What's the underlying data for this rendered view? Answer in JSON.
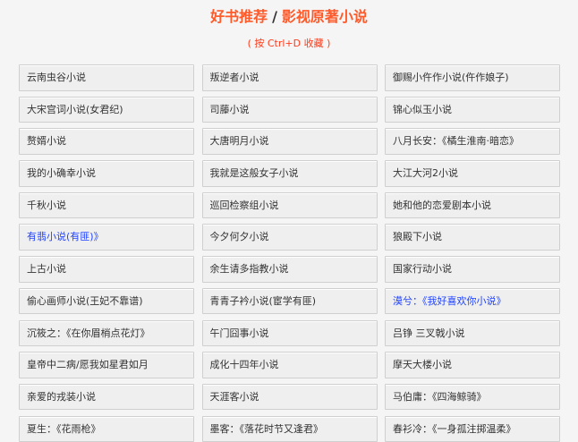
{
  "header": {
    "title_left": "好书推荐",
    "title_sep": "/",
    "title_right": "影视原著小说",
    "hint": "( 按 Ctrl+D 收藏 )"
  },
  "link_color_highlight": "#2244ff",
  "links": [
    {
      "label": "云南虫谷小说",
      "highlight": false
    },
    {
      "label": "叛逆者小说",
      "highlight": false
    },
    {
      "label": "御赐小仵作小说(仵作娘子)",
      "highlight": false
    },
    {
      "label": "大宋宫词小说(女君纪)",
      "highlight": false
    },
    {
      "label": "司藤小说",
      "highlight": false
    },
    {
      "label": "锦心似玉小说",
      "highlight": false
    },
    {
      "label": "赘婿小说",
      "highlight": false
    },
    {
      "label": "大唐明月小说",
      "highlight": false
    },
    {
      "label": "八月长安：《橘生淮南·暗恋》",
      "highlight": false
    },
    {
      "label": "我的小确幸小说",
      "highlight": false
    },
    {
      "label": "我就是这般女子小说",
      "highlight": false
    },
    {
      "label": "大江大河2小说",
      "highlight": false
    },
    {
      "label": "千秋小说",
      "highlight": false
    },
    {
      "label": "巡回检察组小说",
      "highlight": false
    },
    {
      "label": "她和他的恋爱剧本小说",
      "highlight": false
    },
    {
      "label": "有翡小说(有匪)》",
      "highlight": true
    },
    {
      "label": "今夕何夕小说",
      "highlight": false
    },
    {
      "label": "狼殿下小说",
      "highlight": false
    },
    {
      "label": "上古小说",
      "highlight": false
    },
    {
      "label": "余生请多指教小说",
      "highlight": false
    },
    {
      "label": "国家行动小说",
      "highlight": false
    },
    {
      "label": "偷心画师小说(王妃不靠谱)",
      "highlight": false
    },
    {
      "label": "青青子衿小说(宦学有匪)",
      "highlight": false
    },
    {
      "label": "漠兮：《我好喜欢你小说》",
      "highlight": true
    },
    {
      "label": "沉筱之：《在你眉梢点花灯》",
      "highlight": false
    },
    {
      "label": "午门囧事小说",
      "highlight": false
    },
    {
      "label": "吕铮 三叉戟小说",
      "highlight": false
    },
    {
      "label": "皇帝中二病/愿我如星君如月",
      "highlight": false
    },
    {
      "label": "成化十四年小说",
      "highlight": false
    },
    {
      "label": "摩天大楼小说",
      "highlight": false
    },
    {
      "label": "亲爱的戎装小说",
      "highlight": false
    },
    {
      "label": "天涯客小说",
      "highlight": false
    },
    {
      "label": "马伯庸：《四海鲸骑》",
      "highlight": false
    },
    {
      "label": "夏生：《花雨枪》",
      "highlight": false
    },
    {
      "label": "墨客：《落花时节又逢君》",
      "highlight": false
    },
    {
      "label": "春衫冷：《一身孤注掷温柔》",
      "highlight": false
    }
  ]
}
